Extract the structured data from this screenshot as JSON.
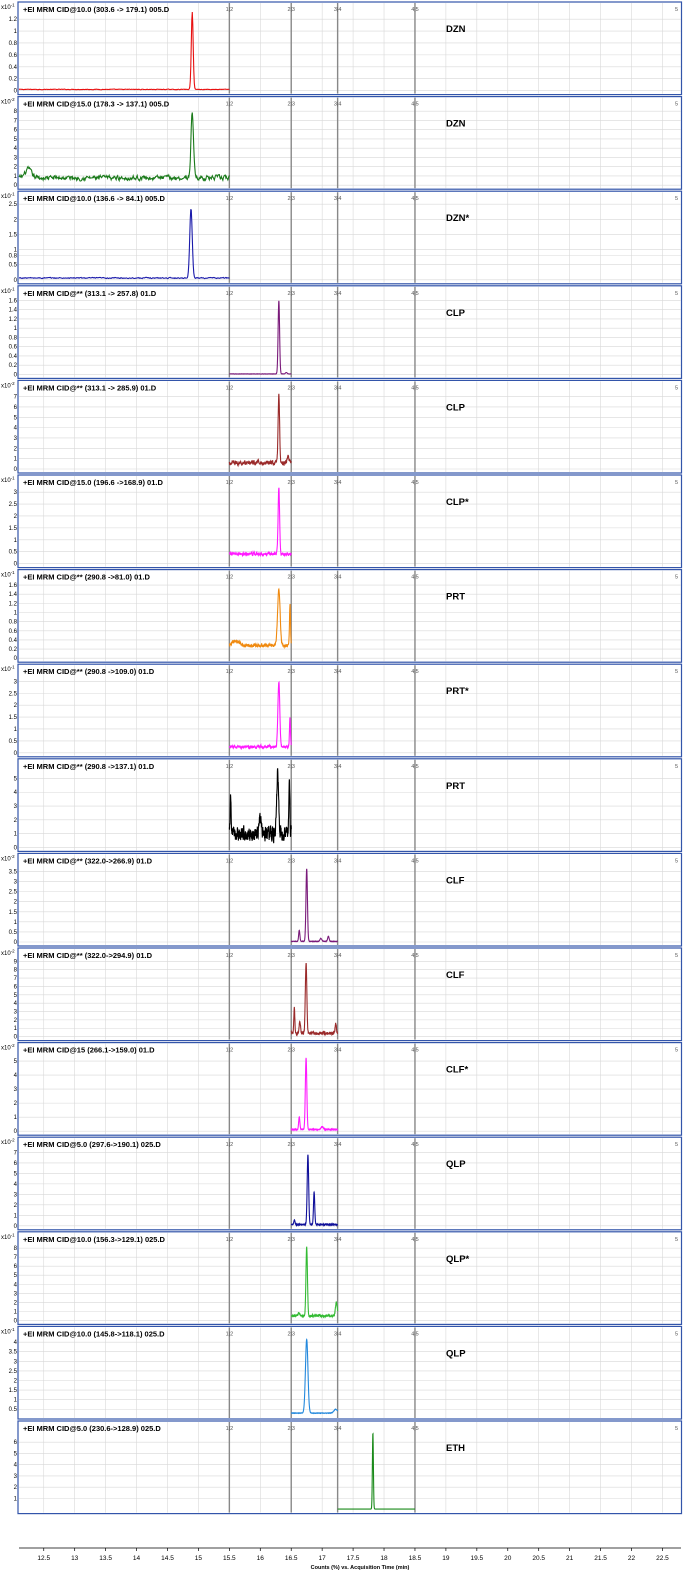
{
  "chart_data": {
    "type": "line",
    "xlabel": "Counts (%) vs. Acquisition Time (min)",
    "x_ticks": [
      "12.5",
      "13",
      "13.5",
      "14",
      "14.5",
      "15",
      "15.5",
      "16",
      "16.5",
      "17",
      "17.5",
      "18",
      "18.5",
      "19",
      "19.5",
      "20",
      "20.5",
      "21",
      "21.5",
      "22",
      "22.5"
    ],
    "xlim": [
      12.1,
      22.8
    ],
    "segment_boundaries": [
      {
        "x": 15.5,
        "label": "1|2"
      },
      {
        "x": 16.5,
        "label": "2|3"
      },
      {
        "x": 17.25,
        "label": "3|4"
      },
      {
        "x": 18.5,
        "label": "4|5"
      }
    ],
    "right_edge_label": "5",
    "colors": {
      "frame": "#3355aa",
      "grid": "#d8d8d8",
      "segment_line": "#888888"
    },
    "panels": [
      {
        "title": "+EI MRM CID@10.0 (303.6 -> 179.1) 005.D",
        "label": "DZN",
        "exp": "x10",
        "exp_power": "-1",
        "yticks": [
          "0",
          "0.2",
          "0.4",
          "0.6",
          "0.8",
          "1",
          "1.2"
        ],
        "ymax": 1.32,
        "color": "#e81010",
        "xrange": [
          12.1,
          15.5
        ],
        "baseline": 0.02,
        "noise": 0.008,
        "peaks": [
          {
            "x": 14.9,
            "h": 1.3,
            "w": 0.015
          }
        ]
      },
      {
        "title": "+EI MRM CID@15.0 (178.3 -> 137.1) 005.D",
        "label": "DZN",
        "exp": "x10",
        "exp_power": "-2",
        "yticks": [
          "0",
          "1",
          "2",
          "3",
          "4",
          "5",
          "6",
          "7",
          "8"
        ],
        "ymax": 8.5,
        "color": "#1a7a1a",
        "xrange": [
          12.1,
          15.5
        ],
        "baseline": 0.8,
        "noise": 0.45,
        "peaks": [
          {
            "x": 14.9,
            "h": 7.2,
            "w": 0.02
          },
          {
            "x": 12.25,
            "h": 0.9,
            "w": 0.05
          }
        ]
      },
      {
        "title": "+EI MRM CID@10.0 (136.6 -> 84.1) 005.D",
        "label": "DZN*",
        "exp": "x10",
        "exp_power": "-1",
        "yticks": [
          "0",
          "0.5",
          "0.8",
          "1",
          "1.5",
          "2",
          "2.5"
        ],
        "ymax": 2.6,
        "color": "#1a1aaa",
        "xrange": [
          12.1,
          15.5
        ],
        "baseline": 0.06,
        "noise": 0.03,
        "peaks": [
          {
            "x": 14.88,
            "h": 2.3,
            "w": 0.02
          }
        ]
      },
      {
        "title": "+EI MRM CID@** (313.1 -> 257.8) 01.D",
        "label": "CLP",
        "exp": "x10",
        "exp_power": "-1",
        "yticks": [
          "0",
          "0.2",
          "0.4",
          "0.6",
          "0.8",
          "1",
          "1.2",
          "1.4",
          "1.6"
        ],
        "ymax": 1.7,
        "color": "#7a1a7a",
        "xrange": [
          15.5,
          16.5
        ],
        "baseline": 0.01,
        "noise": 0.005,
        "peaks": [
          {
            "x": 16.3,
            "h": 1.58,
            "w": 0.012
          },
          {
            "x": 16.42,
            "h": 0.03,
            "w": 0.015
          }
        ]
      },
      {
        "title": "+EI MRM CID@** (313.1 -> 285.9) 01.D",
        "label": "CLP",
        "exp": "x10",
        "exp_power": "-2",
        "yticks": [
          "0",
          "1",
          "2",
          "3",
          "4",
          "5",
          "6",
          "7"
        ],
        "ymax": 7.6,
        "color": "#9a2a2a",
        "xrange": [
          15.5,
          16.5
        ],
        "baseline": 0.6,
        "noise": 0.35,
        "peaks": [
          {
            "x": 16.3,
            "h": 6.6,
            "w": 0.012
          },
          {
            "x": 16.45,
            "h": 0.6,
            "w": 0.02
          }
        ]
      },
      {
        "title": "+EI MRM CID@15.0 (196.6 ->168.9) 01.D",
        "label": "CLP*",
        "exp": "x10",
        "exp_power": "-1",
        "yticks": [
          "0",
          "0.5",
          "1",
          "1.5",
          "2",
          "2.5",
          "3"
        ],
        "ymax": 3.3,
        "color": "#ff1aff",
        "xrange": [
          15.5,
          16.5
        ],
        "baseline": 0.4,
        "noise": 0.12,
        "peaks": [
          {
            "x": 16.3,
            "h": 2.8,
            "w": 0.012
          }
        ]
      },
      {
        "title": "+EI MRM CID@** (290.8 ->81.0) 01.D",
        "label": "PRT",
        "exp": "x10",
        "exp_power": "-1",
        "yticks": [
          "0",
          "0.2",
          "0.4",
          "0.6",
          "0.8",
          "1",
          "1.2",
          "1.4",
          "1.6"
        ],
        "ymax": 1.72,
        "color": "#f08a10",
        "xrange": [
          15.5,
          16.5
        ],
        "baseline": 0.28,
        "noise": 0.06,
        "peaks": [
          {
            "x": 16.3,
            "h": 1.25,
            "w": 0.02
          },
          {
            "x": 16.48,
            "h": 0.9,
            "w": 0.008
          },
          {
            "x": 15.6,
            "h": 0.1,
            "w": 0.05
          }
        ]
      },
      {
        "title": "+EI MRM CID@** (290.8 ->109.0) 01.D",
        "label": "PRT*",
        "exp": "x10",
        "exp_power": "-1",
        "yticks": [
          "0",
          "0.5",
          "1",
          "1.5",
          "2",
          "2.5",
          "3"
        ],
        "ymax": 3.3,
        "color": "#ff1aff",
        "xrange": [
          15.5,
          16.5
        ],
        "baseline": 0.25,
        "noise": 0.1,
        "peaks": [
          {
            "x": 16.3,
            "h": 2.75,
            "w": 0.015
          },
          {
            "x": 16.48,
            "h": 1.2,
            "w": 0.008
          }
        ]
      },
      {
        "title": "+EI MRM CID@** (290.8 ->137.1) 01.D",
        "label": "PRT",
        "exp": "",
        "exp_power": "",
        "yticks": [
          "0",
          "1",
          "2",
          "3",
          "4",
          "5"
        ],
        "ymax": 5.7,
        "color": "#000000",
        "xrange": [
          15.5,
          16.5
        ],
        "baseline": 1.0,
        "noise": 0.9,
        "peaks": [
          {
            "x": 16.28,
            "h": 4.5,
            "w": 0.015
          },
          {
            "x": 16.47,
            "h": 4.0,
            "w": 0.008
          },
          {
            "x": 15.52,
            "h": 2.3,
            "w": 0.008
          },
          {
            "x": 16.0,
            "h": 1.2,
            "w": 0.02
          }
        ]
      },
      {
        "title": "+EI MRM CID@** (322.0->266.9) 01.D",
        "label": "CLF",
        "exp": "x10",
        "exp_power": "-2",
        "yticks": [
          "0",
          "0.5",
          "1",
          "1.5",
          "2",
          "2.5",
          "3",
          "3.5"
        ],
        "ymax": 3.9,
        "color": "#7a1a7a",
        "xrange": [
          16.5,
          17.25
        ],
        "baseline": 0.03,
        "noise": 0.02,
        "peaks": [
          {
            "x": 16.75,
            "h": 3.6,
            "w": 0.012
          },
          {
            "x": 16.63,
            "h": 0.55,
            "w": 0.01
          },
          {
            "x": 16.98,
            "h": 0.15,
            "w": 0.015
          },
          {
            "x": 17.1,
            "h": 0.25,
            "w": 0.012
          }
        ]
      },
      {
        "title": "+EI MRM CID@** (322.0->294.9) 01.D",
        "label": "CLF",
        "exp": "x10",
        "exp_power": "-2",
        "yticks": [
          "0",
          "1",
          "2",
          "3",
          "4",
          "5",
          "6",
          "7",
          "8",
          "9"
        ],
        "ymax": 9.4,
        "color": "#9a2a2a",
        "xrange": [
          16.5,
          17.25
        ],
        "baseline": 0.4,
        "noise": 0.3,
        "peaks": [
          {
            "x": 16.74,
            "h": 8.4,
            "w": 0.012
          },
          {
            "x": 16.55,
            "h": 3.0,
            "w": 0.008
          },
          {
            "x": 16.64,
            "h": 1.5,
            "w": 0.01
          },
          {
            "x": 17.22,
            "h": 1.2,
            "w": 0.01
          }
        ]
      },
      {
        "title": "+EI MRM CID@15 (266.1->159.0) 01.D",
        "label": "CLF*",
        "exp": "x10",
        "exp_power": "-2",
        "yticks": [
          "0",
          "1",
          "2",
          "3",
          "4",
          "5"
        ],
        "ymax": 5.6,
        "color": "#ff1aff",
        "xrange": [
          16.5,
          17.25
        ],
        "baseline": 0.12,
        "noise": 0.05,
        "peaks": [
          {
            "x": 16.74,
            "h": 5.1,
            "w": 0.012
          },
          {
            "x": 16.63,
            "h": 0.9,
            "w": 0.01
          },
          {
            "x": 17.0,
            "h": 0.2,
            "w": 0.02
          }
        ]
      },
      {
        "title": "+EI MRM CID@5.0 (297.6->190.1) 025.D",
        "label": "QLP",
        "exp": "x10",
        "exp_power": "-2",
        "yticks": [
          "0",
          "1",
          "2",
          "3",
          "4",
          "5",
          "6",
          "7"
        ],
        "ymax": 7.5,
        "color": "#10109a",
        "xrange": [
          16.5,
          17.25
        ],
        "baseline": 0.12,
        "noise": 0.08,
        "peaks": [
          {
            "x": 16.77,
            "h": 6.7,
            "w": 0.012
          },
          {
            "x": 16.87,
            "h": 3.1,
            "w": 0.01
          },
          {
            "x": 16.55,
            "h": 0.4,
            "w": 0.01
          }
        ]
      },
      {
        "title": "+EI MRM CID@10.0 (156.3->129.1) 025.D",
        "label": "QLP*",
        "exp": "x10",
        "exp_power": "-1",
        "yticks": [
          "0",
          "1",
          "2",
          "3",
          "4",
          "5",
          "6",
          "7",
          "8"
        ],
        "ymax": 8.7,
        "color": "#33bb33",
        "xrange": [
          16.5,
          17.25
        ],
        "baseline": 0.5,
        "noise": 0.2,
        "peaks": [
          {
            "x": 16.75,
            "h": 7.6,
            "w": 0.012
          },
          {
            "x": 17.23,
            "h": 1.5,
            "w": 0.015
          },
          {
            "x": 16.62,
            "h": 0.4,
            "w": 0.01
          }
        ]
      },
      {
        "title": "+EI MRM CID@10.0 (145.8->118.1) 025.D",
        "label": "QLP",
        "exp": "x10",
        "exp_power": "-1",
        "yticks": [
          "0.5",
          "1",
          "1.5",
          "2",
          "2.5",
          "3",
          "3.5",
          "4"
        ],
        "ymax": 4.3,
        "ymin": 0.2,
        "color": "#2288dd",
        "xrange": [
          16.5,
          17.25
        ],
        "baseline": 0.3,
        "noise": 0.02,
        "peaks": [
          {
            "x": 16.75,
            "h": 3.85,
            "w": 0.02
          },
          {
            "x": 17.22,
            "h": 0.2,
            "w": 0.03
          }
        ]
      },
      {
        "title": "+EI MRM CID@5.0 (230.6->128.9) 025.D",
        "label": "ETH",
        "exp": "",
        "exp_power": "",
        "yticks": [
          "1",
          "2",
          "3",
          "4",
          "5",
          "6"
        ],
        "ymax": 7.0,
        "color": "#1a8a1a",
        "xrange": [
          17.25,
          18.5
        ],
        "baseline": 0.05,
        "noise": 0.0,
        "peaks": [
          {
            "x": 17.82,
            "h": 6.8,
            "w": 0.008
          }
        ]
      }
    ]
  }
}
